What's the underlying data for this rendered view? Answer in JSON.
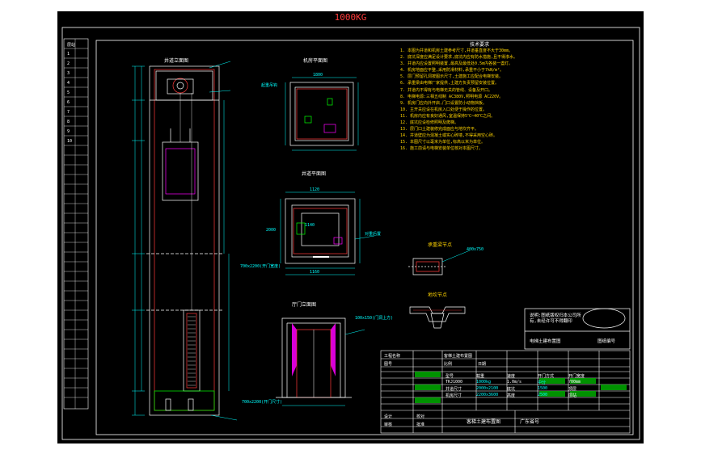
{
  "title": "1000KG",
  "views": {
    "elevation": {
      "label": "井道立面图"
    },
    "machine_room_plan": {
      "label": "机房平面图",
      "dim_width": "1800",
      "hook": "起重吊钩"
    },
    "shaft_plan": {
      "label": "井道平面图",
      "dims": [
        "1120",
        "1140",
        "1160",
        "2000"
      ],
      "note1": "700x2200(开门宽度)",
      "note2": "对重后置"
    },
    "door_elevation": {
      "label": "厅门立面图",
      "note1": "100x150(门洞上方)",
      "note2": "700x2200(开门尺寸)"
    },
    "beam_detail": {
      "label": "承重梁节点",
      "note": "400x750"
    },
    "sill_detail": {
      "label": "地坎节点"
    }
  },
  "notes": {
    "heading": "技术要求",
    "items": [
      "1. 本图为井道和机房土建参考尺寸,井道垂直度不大于30mm。",
      "2. 底坑深度应满足设计要求,底坑内应有防水措施,且不得渗水。",
      "3. 井道内应设置照明装置,最高及最低处0.5m内各装一盏灯。",
      "4. 机房地面应平整,采用防滑材料,承重不小于7kN/m²。",
      "5. 层门预留孔洞按图示尺寸,土建施工应配合电梯安装。",
      "6. 承重梁由电梯厂家提供,土建方负责预留安装位置。",
      "7. 井道内不得有与电梯无关的管线、设备及开口。",
      "8. 电梯电源:三相五线制 AC380V,照明电源 AC220V。",
      "9. 机房门应向外开启,门口设置防小动物挡板。",
      "10. 主开关应设在机房入口处便于操作的位置。",
      "11. 机房内应有良好通风,室温保持5℃~40℃之间。",
      "12. 底坑应设检修照明及爬梯。",
      "13. 层门口土建装修完成面应与地坎齐平。",
      "14. 井道壁应为混凝土或实心砖墙,不得采用空心砖。",
      "15. 本图尺寸以毫米为单位,标高以米为单位。",
      "16. 施工前请与电梯安装单位核对本图尺寸。"
    ]
  },
  "elevator_specs": {
    "headers": [
      "型号",
      "载重",
      "速度",
      "开门方式",
      "开门宽度"
    ],
    "rows": [
      [
        "TKJ1000",
        "1000kg",
        "1.0m/s",
        "中分",
        "700mm"
      ],
      [
        "井道尺寸",
        "2000x2100",
        "底坑",
        "1500",
        "顶层"
      ],
      [
        "机房尺寸",
        "2200x3600",
        "高度",
        "2500",
        "层站"
      ]
    ]
  },
  "title_block": {
    "project": "客梯土建布置图",
    "project_label": "工程名称",
    "sheet_label": "图号",
    "company": "广东省号",
    "scale_label": "比例",
    "date_label": "日期",
    "labels": [
      "设计",
      "审核",
      "校对",
      "批准"
    ],
    "certificate_text": "说明:图纸版权归本公司所有,未经许可不得翻印",
    "right_top": "电梯土建布置图",
    "right_code": "图纸编号"
  },
  "left_strip": {
    "items": [
      "层站",
      "1",
      "2",
      "3",
      "4",
      "5",
      "6",
      "7",
      "8",
      "9",
      "10"
    ]
  },
  "colors": {
    "frame": "#ffffff",
    "dims": "#00ffff",
    "notes": "#ffd400",
    "red": "#ff3b3b",
    "green": "#00ff00",
    "magenta": "#ff00ff"
  }
}
